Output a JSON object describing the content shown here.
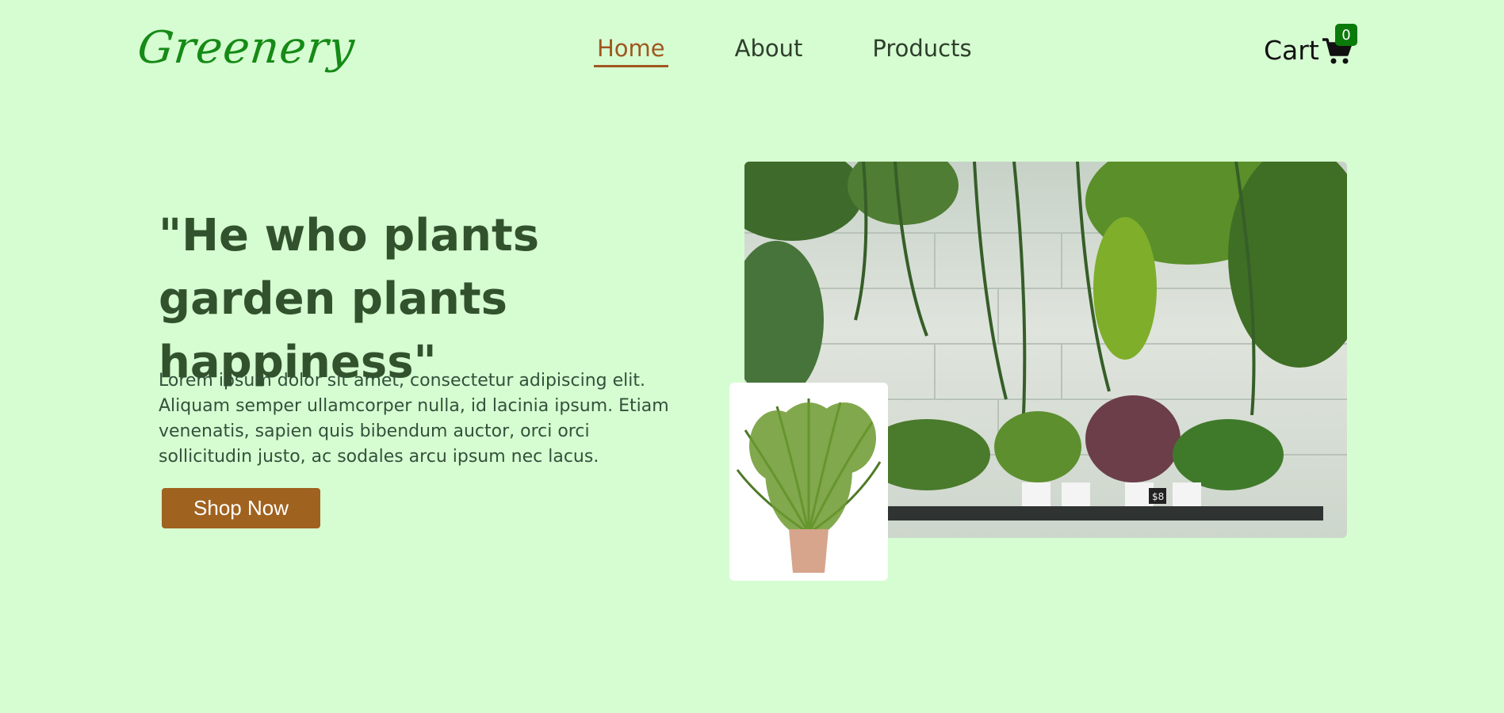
{
  "brand": {
    "logo_text": "Greenery",
    "logo_color": "#168a16"
  },
  "nav": {
    "items": [
      {
        "label": "Home",
        "active": true
      },
      {
        "label": "About",
        "active": false
      },
      {
        "label": "Products",
        "active": false
      }
    ],
    "active_color": "#a0561f"
  },
  "cart": {
    "label": "Cart",
    "count": "0",
    "icon": "shopping-cart-icon"
  },
  "hero": {
    "title": "\"He who plants garden plants happiness\"",
    "description": "Lorem ipsum dolor sit amet, consectetur adipiscing elit. Aliquam semper ullamcorper nulla, id lacinia ipsum. Etiam venenatis, sapien quis bibendum auctor, orci orci sollicitudin justo, ac sodales arcu ipsum nec lacus.",
    "button_label": "Shop Now"
  },
  "colors": {
    "background": "#d6fdd2",
    "title": "#32522d",
    "button": "#a0621f",
    "badge": "#0a7a0a"
  },
  "images": {
    "main_photo": "plant-wall-photo",
    "inset_photo": "potted-palm-photo",
    "price_tag_text": "$8"
  }
}
